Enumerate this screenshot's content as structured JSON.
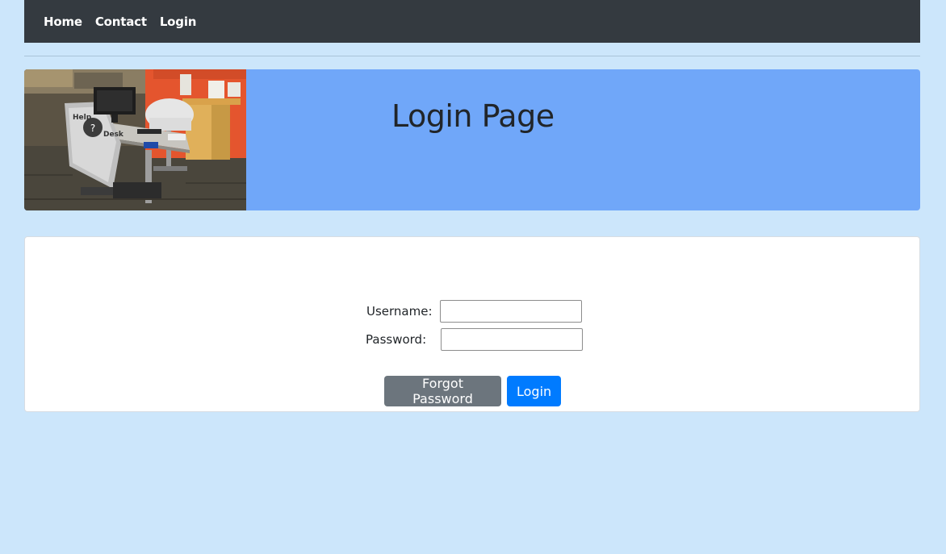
{
  "nav": {
    "items": [
      {
        "label": "Home"
      },
      {
        "label": "Contact"
      },
      {
        "label": "Login"
      }
    ]
  },
  "banner": {
    "title": "Login Page",
    "image_label": "Help Desk"
  },
  "form": {
    "username_label": "Username:",
    "username_value": "",
    "password_label": "Password:",
    "password_value": "",
    "forgot_label": "Forgot Password",
    "login_label": "Login"
  },
  "colors": {
    "background": "#cce6fb",
    "navbar": "#343a40",
    "banner": "#70a7f9",
    "button_secondary": "#6c757d",
    "button_primary": "#007bff"
  }
}
